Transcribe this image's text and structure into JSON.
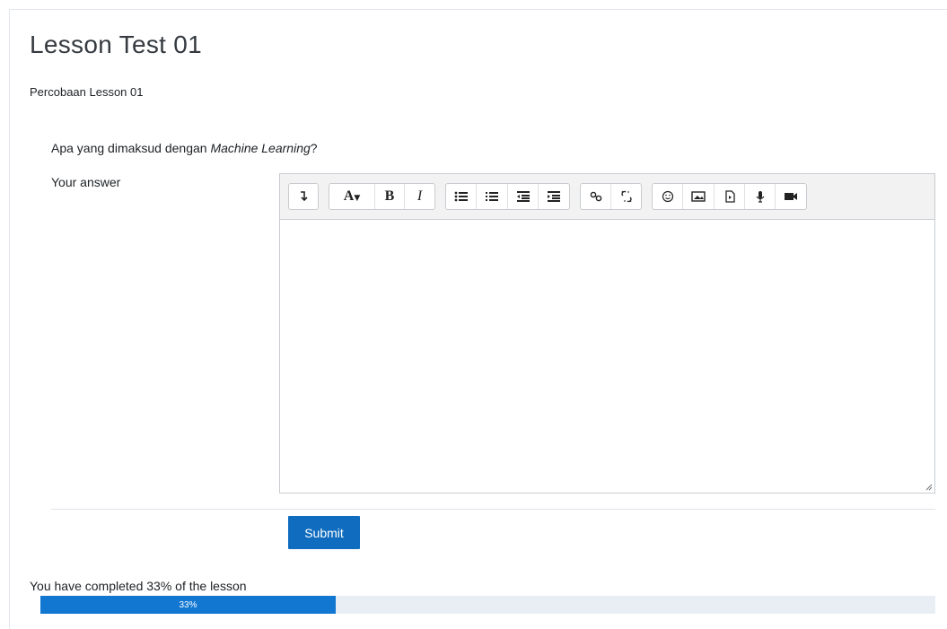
{
  "page": {
    "title": "Lesson Test 01",
    "subtitle": "Percobaan Lesson 01"
  },
  "question": {
    "prefix": "Apa yang dimaksud dengan ",
    "emphasis": "Machine Learning",
    "suffix": "?",
    "answer_label": "Your answer"
  },
  "editor": {
    "content": "",
    "toolbar_groups": [
      [
        "collapse-icon"
      ],
      [
        "font-color-icon",
        "bold-icon",
        "italic-icon"
      ],
      [
        "unordered-list-icon",
        "ordered-list-icon",
        "outdent-icon",
        "indent-icon"
      ],
      [
        "link-icon",
        "unlink-icon"
      ],
      [
        "emoji-icon",
        "image-icon",
        "media-icon",
        "record-audio-icon",
        "record-video-icon"
      ]
    ]
  },
  "actions": {
    "submit_label": "Submit"
  },
  "progress": {
    "text": "You have completed 33% of the lesson",
    "percent": 33,
    "label": "33%"
  },
  "colors": {
    "primary": "#0f6cbf",
    "progress_fill": "#1177d1",
    "progress_track": "#e9eef4",
    "toolbar_bg": "#f2f2f2"
  }
}
